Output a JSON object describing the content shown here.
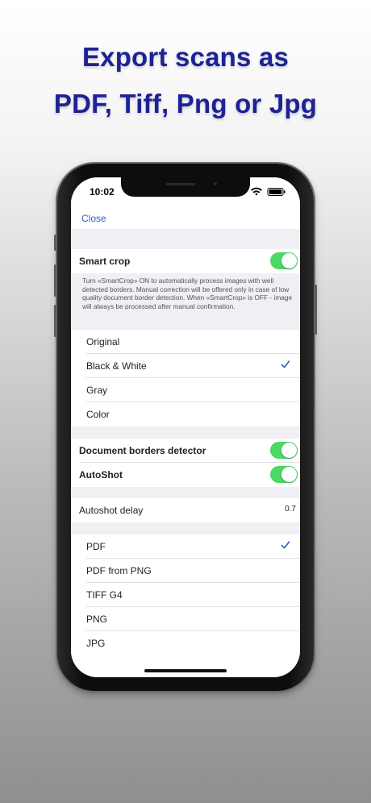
{
  "headline": {
    "line1": "Export scans as",
    "line2": "PDF, Tiff, Png or Jpg"
  },
  "status_bar": {
    "time": "10:02",
    "icons": [
      "wifi-icon",
      "battery-icon"
    ]
  },
  "nav": {
    "close_label": "Close"
  },
  "smart_crop": {
    "label": "Smart crop",
    "enabled": true,
    "description": "Turn «SmartCrop» ON to automatically process images with well detected borders. Manual correction will be offered only in case of low quality document border detection. When «SmartCrop» is OFF - image will always be processed after manual confirmation."
  },
  "color_modes": {
    "items": [
      "Original",
      "Black & White",
      "Gray",
      "Color"
    ],
    "selected": "Black & White"
  },
  "detection": {
    "borders_label": "Document borders detector",
    "borders_enabled": true,
    "autoshot_label": "AutoShot",
    "autoshot_enabled": true
  },
  "autoshot_delay": {
    "label": "Autoshot delay",
    "value": "0.7"
  },
  "formats": {
    "items": [
      "PDF",
      "PDF from PNG",
      "TIFF G4",
      "PNG",
      "JPG"
    ],
    "selected": "PDF"
  },
  "colors": {
    "headline": "#1d2296",
    "accent": "#2f5dc6",
    "toggle_on": "#4cd964",
    "group_bg": "#efeff4"
  }
}
